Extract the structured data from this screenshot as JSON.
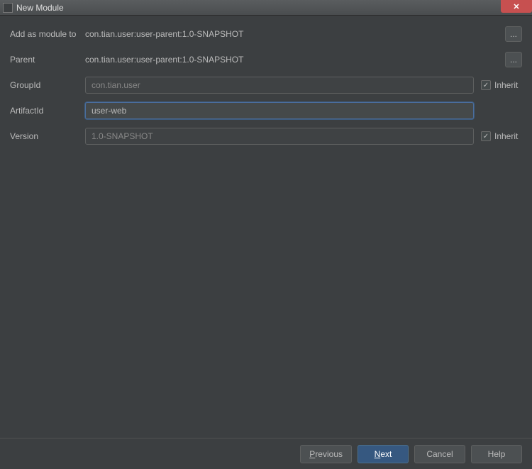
{
  "titlebar": {
    "title": "New Module",
    "close_glyph": "✕"
  },
  "form": {
    "addAsModule": {
      "label": "Add as module to",
      "value": "con.tian.user:user-parent:1.0-SNAPSHOT",
      "ellipsis": "..."
    },
    "parent": {
      "label": "Parent",
      "value": "con.tian.user:user-parent:1.0-SNAPSHOT",
      "ellipsis": "..."
    },
    "groupId": {
      "label": "GroupId",
      "value": "con.tian.user",
      "inherit_label": "Inherit",
      "check_glyph": "✓"
    },
    "artifactId": {
      "label": "ArtifactId",
      "value": "user-web"
    },
    "version": {
      "label": "Version",
      "value": "1.0-SNAPSHOT",
      "inherit_label": "Inherit",
      "check_glyph": "✓"
    }
  },
  "buttons": {
    "previous_pre": "",
    "previous_mn": "P",
    "previous_post": "revious",
    "next_pre": "",
    "next_mn": "N",
    "next_post": "ext",
    "cancel": "Cancel",
    "help": "Help"
  }
}
